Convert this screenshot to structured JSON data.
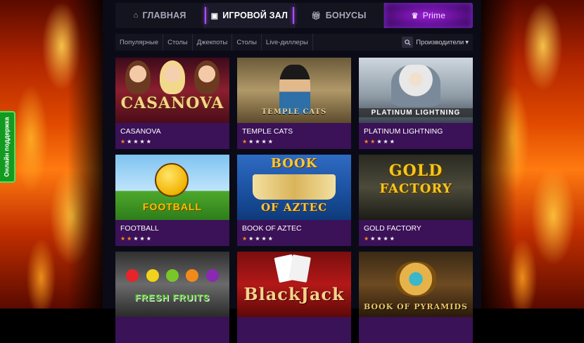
{
  "support": {
    "label": "Онлайн поддержка"
  },
  "nav": {
    "items": [
      {
        "label": "ГЛАВНАЯ",
        "icon": "home-icon"
      },
      {
        "label": "ИГРОВОЙ ЗАЛ",
        "icon": "slot-machine-icon"
      },
      {
        "label": "БОНУСЫ",
        "icon": "gift-icon"
      },
      {
        "label": "Prime",
        "icon": "prime-logo-icon"
      }
    ],
    "active": "ИГРОВОЙ ЗАЛ"
  },
  "filters": {
    "items": [
      "Популярные",
      "Столы",
      "Джекпоты",
      "Столы",
      "Live-диллеры"
    ],
    "providers_label": "Производители"
  },
  "games": [
    {
      "title": "CASANOVA",
      "thumb_text": "CASANOVA",
      "rating": 1
    },
    {
      "title": "TEMPLE CATS",
      "thumb_text": "TEMPLE CATS",
      "rating": 1
    },
    {
      "title": "PLATINUM LIGHTNING",
      "thumb_text": "PLATINUM LIGHTNING",
      "rating": 2
    },
    {
      "title": "FOOTBALL",
      "thumb_text": "FOOTBALL",
      "rating": 2
    },
    {
      "title": "BOOK OF AZTEC",
      "thumb_text_1": "BOOK",
      "thumb_text_2": "OF AZTEC",
      "rating": 1
    },
    {
      "title": "GOLD FACTORY",
      "thumb_text_1": "GOLD",
      "thumb_text_2": "FACTORY",
      "rating": 1
    },
    {
      "title": "",
      "thumb_text": "FRESH FRUITS",
      "rating": 0
    },
    {
      "title": "",
      "thumb_text": "BlackJack",
      "rating": 0
    },
    {
      "title": "",
      "thumb_text": "BOOK OF PYRAMIDS",
      "rating": 0
    }
  ],
  "colors": {
    "accent": "#b14cff",
    "card_bg": "#3b1158",
    "star_on": "#ff8a1c",
    "support": "#129b20"
  }
}
